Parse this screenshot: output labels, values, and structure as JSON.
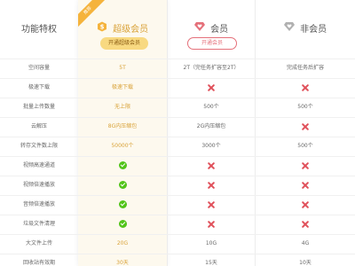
{
  "header": {
    "feature_label": "功能特权",
    "ribbon": "推荐",
    "super": {
      "title": "超级会员",
      "icon": "s-badge-icon",
      "button": "开通超级会员",
      "color": "#f5a623"
    },
    "member": {
      "title": "会员",
      "icon": "heart-diamond-icon",
      "button": "开通会员",
      "color": "#e5707a"
    },
    "non": {
      "title": "非会员",
      "icon": "gray-diamond-icon",
      "color": "#999999"
    }
  },
  "rows": [
    {
      "feature": "空间容量",
      "super": "5T",
      "member": "2T（完任务扩容至2T）",
      "non": "完成任务后扩容"
    },
    {
      "feature": "极速下载",
      "super": "极速下载",
      "member": "cross",
      "non": "cross"
    },
    {
      "feature": "批量上传数量",
      "super": "无上限",
      "member": "500个",
      "non": "500个"
    },
    {
      "feature": "云解压",
      "super": "8G内压缩包",
      "member": "2G内压缩包",
      "non": "cross"
    },
    {
      "feature": "转存文件数上限",
      "super": "50000个",
      "member": "3000个",
      "non": "500个"
    },
    {
      "feature": "视频高速通道",
      "super": "check",
      "member": "cross",
      "non": "cross"
    },
    {
      "feature": "视频倍速播放",
      "super": "check",
      "member": "cross",
      "non": "cross"
    },
    {
      "feature": "音频倍速播放",
      "super": "check",
      "member": "cross",
      "non": "cross"
    },
    {
      "feature": "垃圾文件清理",
      "super": "check",
      "member": "cross",
      "non": "cross"
    },
    {
      "feature": "大文件上传",
      "super": "20G",
      "member": "10G",
      "non": "4G"
    },
    {
      "feature": "回收站有效期",
      "super": "30天",
      "member": "15天",
      "non": "10天"
    }
  ]
}
